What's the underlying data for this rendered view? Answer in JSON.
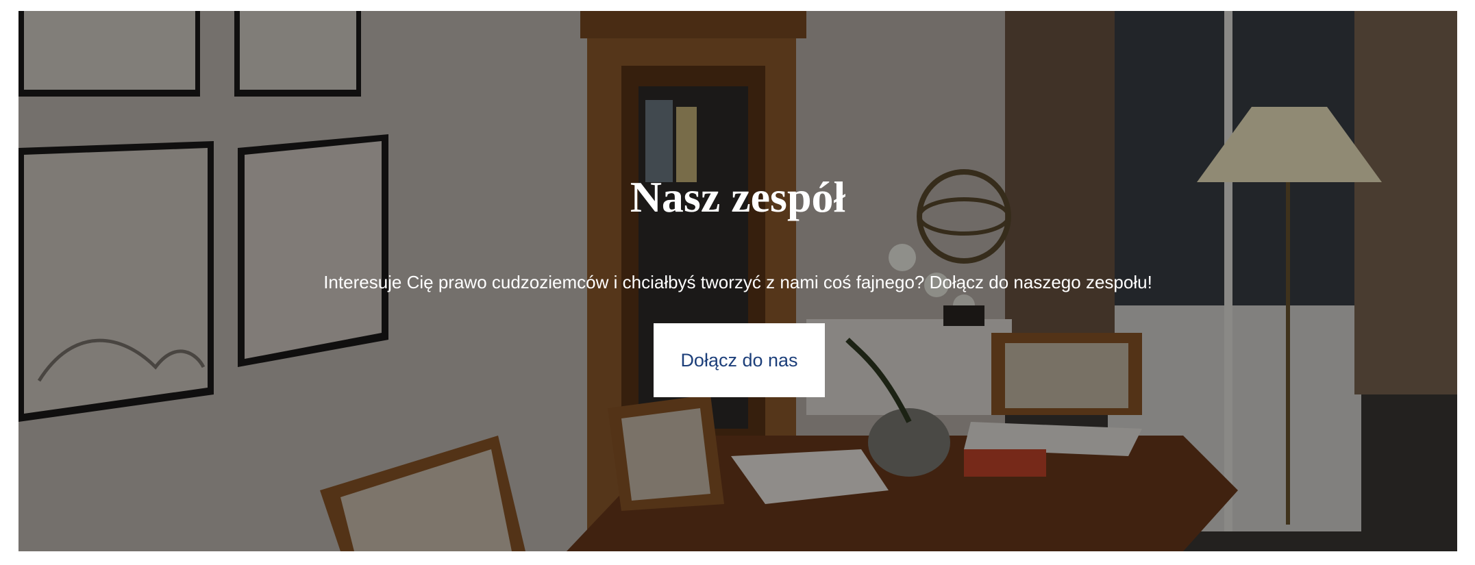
{
  "hero": {
    "title": "Nasz zespół",
    "subtitle": "Interesuje Cię prawo cudzoziemców i chciałbyś tworzyć z nami coś fajnego? Dołącz do naszego zespołu!",
    "cta_label": "Dołącz do nas",
    "background_image": "office-meeting-room-photo",
    "overlay_color": "#000000",
    "cta_text_color": "#1d3f7a",
    "cta_background": "#ffffff"
  }
}
